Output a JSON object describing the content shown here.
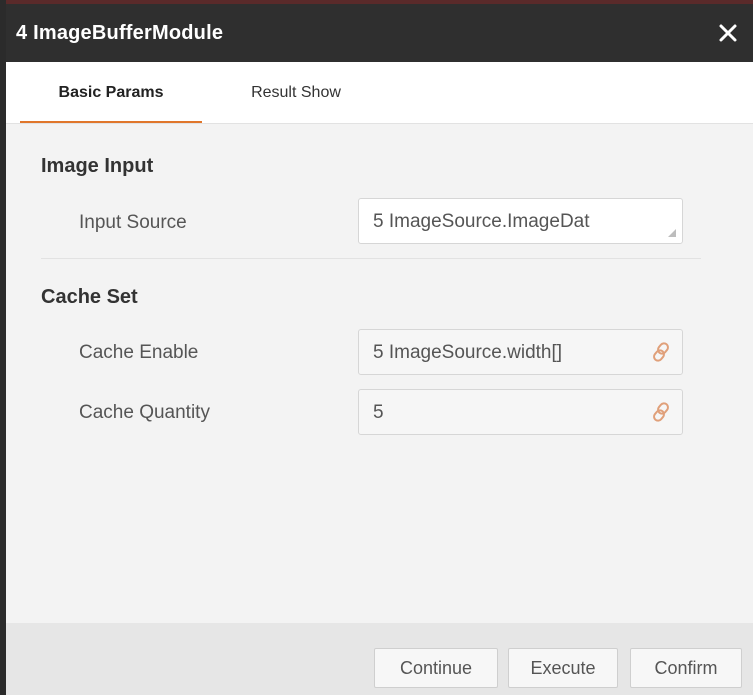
{
  "window": {
    "title": "4 ImageBufferModule",
    "close_icon": "close-icon"
  },
  "tabs": [
    {
      "label": "Basic Params",
      "active": true
    },
    {
      "label": "Result Show",
      "active": false
    }
  ],
  "sections": {
    "image_input": {
      "title": "Image Input",
      "input_source": {
        "label": "Input Source",
        "value": "5 ImageSource.ImageDat"
      }
    },
    "cache_set": {
      "title": "Cache Set",
      "cache_enable": {
        "label": "Cache Enable",
        "value": "5 ImageSource.width[]",
        "icon": "link-icon"
      },
      "cache_quantity": {
        "label": "Cache Quantity",
        "value": "5",
        "icon": "link-icon"
      }
    }
  },
  "footer": {
    "continue_label": "Continue",
    "execute_label": "Execute",
    "confirm_label": "Confirm"
  },
  "colors": {
    "titlebar": "#2f2f2f",
    "tab_accent": "#e0762b",
    "link_icon": "#e0a07a"
  }
}
